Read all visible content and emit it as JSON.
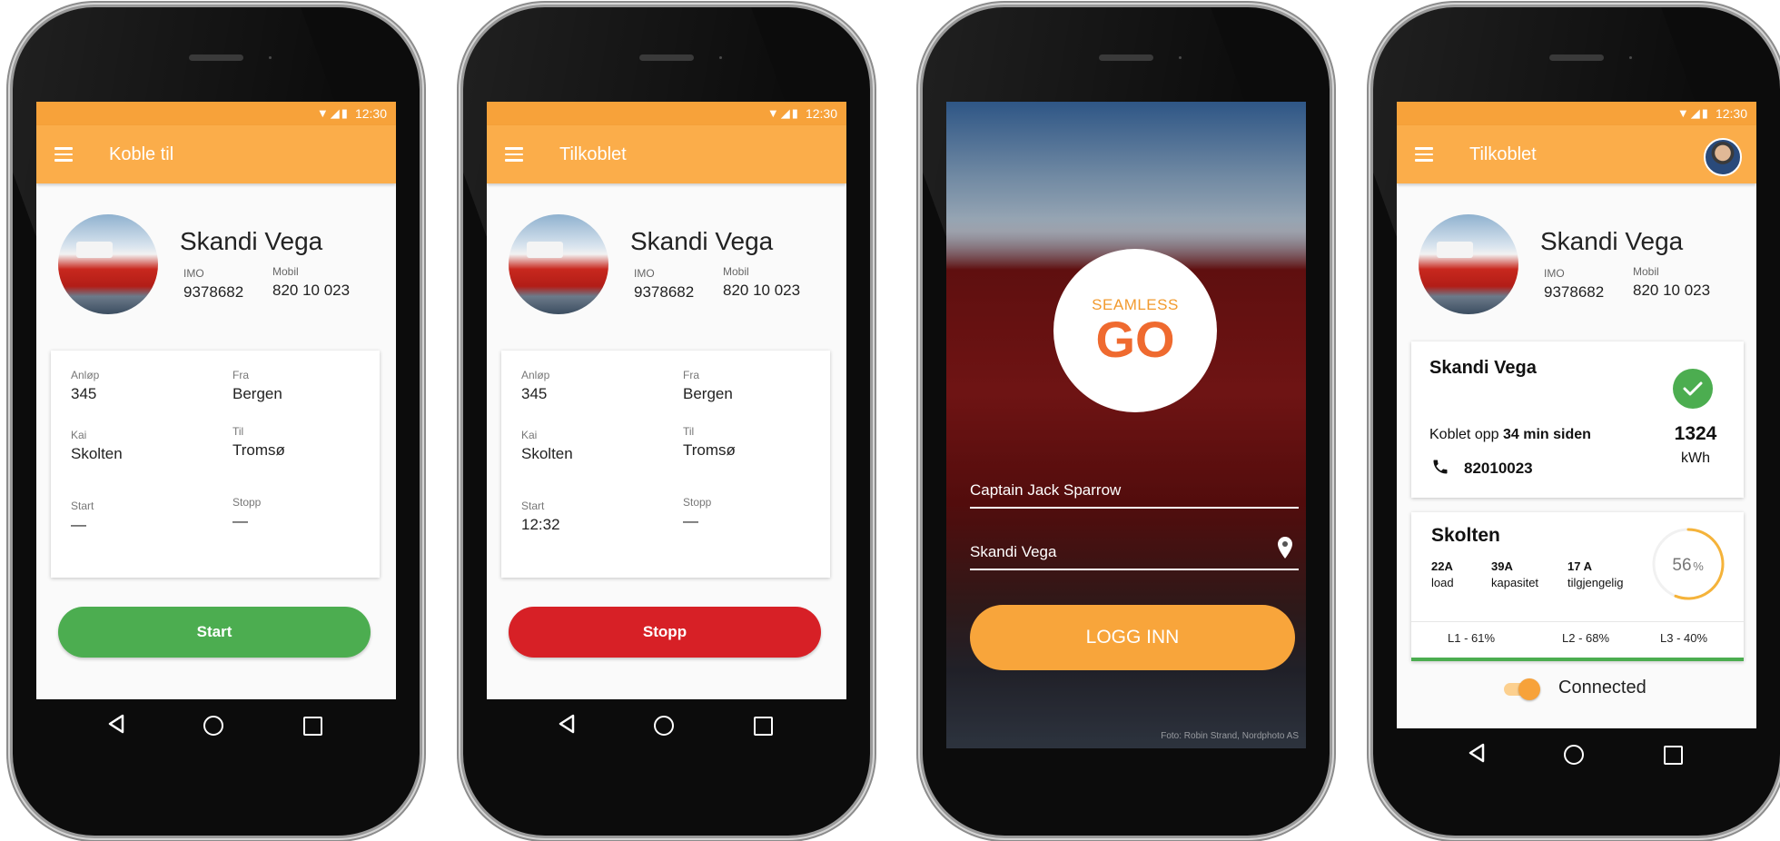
{
  "status": {
    "time": "12:30",
    "icons": "▼◢▮"
  },
  "vessel": {
    "name": "Skandi Vega",
    "imo_label": "IMO",
    "imo": "9378682",
    "mobile_label": "Mobil",
    "mobile": "820 10 023"
  },
  "voyage": {
    "anlop_label": "Anløp",
    "anlop": "345",
    "fra_label": "Fra",
    "fra": "Bergen",
    "kai_label": "Kai",
    "kai": "Skolten",
    "til_label": "Til",
    "til": "Tromsø",
    "start_label": "Start",
    "stopp_label": "Stopp",
    "empty_value": "—",
    "start_time": "12:32"
  },
  "screen1": {
    "title": "Koble til",
    "button": "Start",
    "button_color": "#4cad50"
  },
  "screen2": {
    "title": "Tilkoblet",
    "button": "Stopp",
    "button_color": "#d72026"
  },
  "screen3": {
    "logo_small": "SEAMLESS",
    "logo_big": "GO",
    "username": "Captain Jack Sparrow",
    "vessel": "Skandi Vega",
    "login_button": "LOGG INN",
    "photo_credit": "Foto: Robin Strand, Nordphoto AS"
  },
  "screen4": {
    "title": "Tilkoblet",
    "connection_card": {
      "title": "Skandi Vega",
      "connected_prefix": "Koblet opp",
      "connected_time": "34 min siden",
      "phone": "82010023",
      "energy_value": "1324",
      "energy_unit": "kWh"
    },
    "port_card": {
      "title": "Skolten",
      "stats": [
        {
          "value": "22A",
          "label": "load"
        },
        {
          "value": "39A",
          "label": "kapasitet"
        },
        {
          "value": "17 A",
          "label": "tilgjengelig"
        }
      ],
      "percent": 56,
      "percent_label": "56",
      "percent_unit": "%",
      "phases": [
        "L1 - 61%",
        "L2 - 68%",
        "L3 - 40%"
      ]
    },
    "toggle_label": "Connected"
  },
  "colors": {
    "orange": "#fbad4a",
    "orange_dark": "#f7a23a",
    "green": "#4cad50",
    "red": "#d72026"
  }
}
